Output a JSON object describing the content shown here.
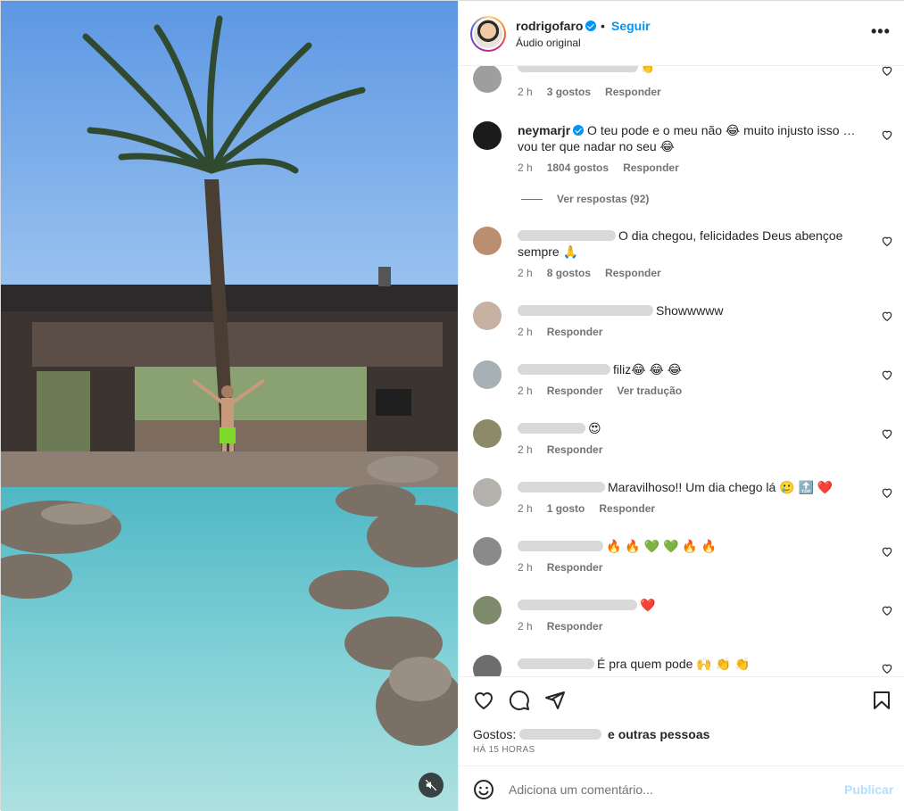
{
  "post": {
    "username": "rodrigofaro",
    "dot": "•",
    "follow_label": "Seguir",
    "audio": "Áudio original",
    "more_icon": "more-horizontal-icon"
  },
  "comments": [
    {
      "text": "👏",
      "time": "2 h",
      "likes": "3 gostos",
      "reply": "Responder",
      "avatar_color": "#9e9e9e"
    },
    {
      "user": "neymarjr",
      "text": "O teu pode e o meu não 😂 muito injusto isso … vou ter que nadar no seu 😂",
      "time": "2 h",
      "likes": "1804 gostos",
      "reply": "Responder",
      "view_replies": "Ver respostas (92)",
      "avatar_color": "#1b1b1b"
    },
    {
      "text": "O dia chegou, felicidades Deus abençoe sempre 🙏",
      "time": "2 h",
      "likes": "8 gostos",
      "reply": "Responder",
      "avatar_color": "#b98f6f"
    },
    {
      "text": "Showwwww",
      "time": "2 h",
      "reply": "Responder",
      "avatar_color": "#c7b1a2"
    },
    {
      "text": "filiz😂 😂 😂",
      "time": "2 h",
      "reply": "Responder",
      "translate": "Ver tradução",
      "avatar_color": "#a7b0b4"
    },
    {
      "text": "😍",
      "time": "2 h",
      "reply": "Responder",
      "avatar_color": "#8d8a6a"
    },
    {
      "text": "Maravilhoso!! Um dia chego lá 🥲 🔝 ❤️",
      "time": "2 h",
      "likes": "1 gosto",
      "reply": "Responder",
      "avatar_color": "#b5b1ad"
    },
    {
      "text": "🔥 🔥 💚 💚 🔥 🔥",
      "time": "2 h",
      "reply": "Responder",
      "avatar_color": "#8a8a8a"
    },
    {
      "text": "❤️",
      "time": "2 h",
      "reply": "Responder",
      "avatar_color": "#7d8a6b"
    },
    {
      "text": "É pra quem pode 🙌 👏 👏",
      "avatar_color": "#6d6d6d"
    }
  ],
  "actions": {
    "like_icon": "heart-icon",
    "comment_icon": "comment-icon",
    "share_icon": "send-icon",
    "save_icon": "bookmark-icon",
    "likes_prefix": "Gostos:",
    "likes_suffix": "e outras pessoas",
    "date": "HÁ 15 HORAS"
  },
  "add_comment": {
    "placeholder": "Adiciona um comentário...",
    "publish_label": "Publicar",
    "emoji_icon": "smiley-icon"
  },
  "media": {
    "mute_icon": "muted-speaker-icon"
  },
  "colors": {
    "accent": "#0095f6",
    "publish_disabled": "#b2dffc",
    "meta_text": "#737373",
    "heart_red": "#ed4956"
  }
}
